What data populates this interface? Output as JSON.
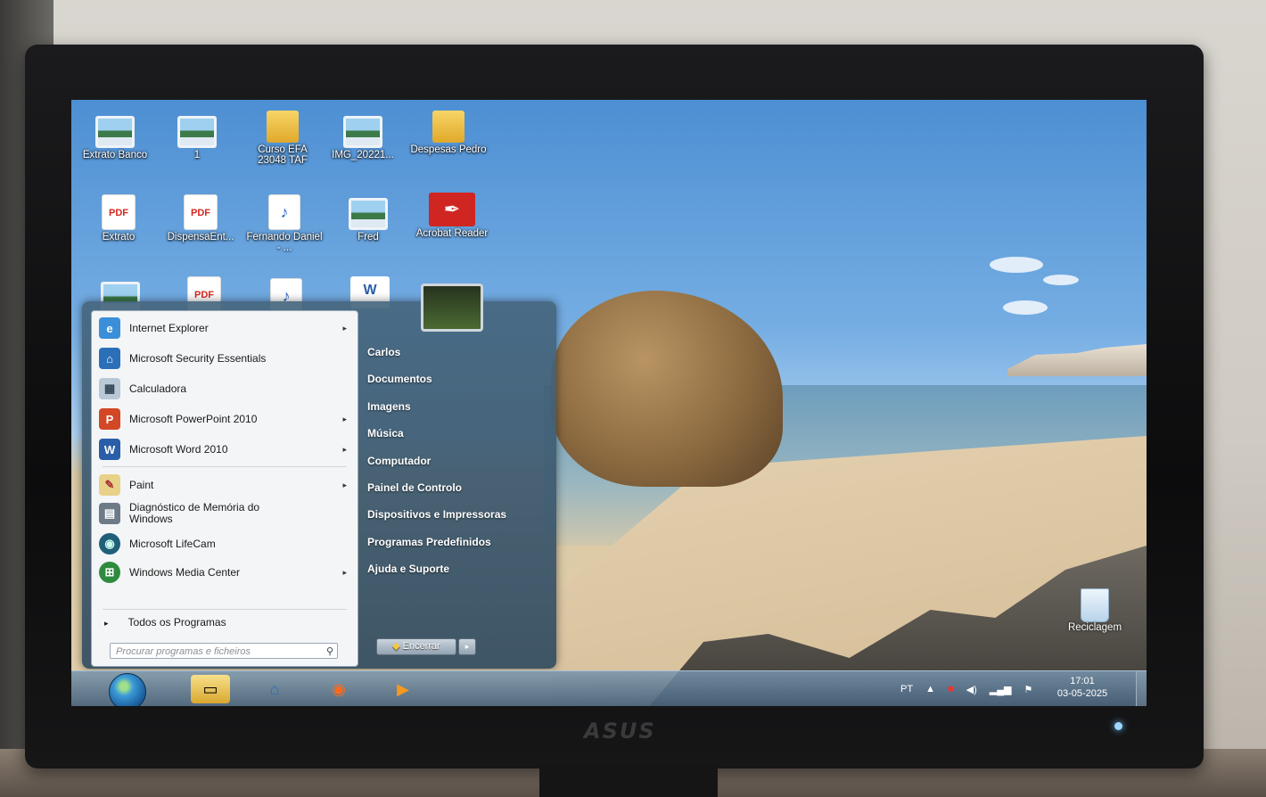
{
  "desktop": {
    "icons": [
      {
        "label": "Extrato Banco",
        "icon": "image-file-icon"
      },
      {
        "label": "1",
        "icon": "image-file-icon"
      },
      {
        "label": "Curso EFA 23048 TAF",
        "icon": "folder-shortcut-icon"
      },
      {
        "label": "IMG_20221...",
        "icon": "image-file-icon"
      },
      {
        "label": "Despesas Pedro",
        "icon": "folder-icon"
      },
      {
        "label": "Extrato",
        "icon": "pdf-icon"
      },
      {
        "label": "DispensaEnt...",
        "icon": "pdf-icon"
      },
      {
        "label": "Fernando Daniel - ...",
        "icon": "mp3-icon"
      },
      {
        "label": "Fred",
        "icon": "image-file-icon"
      },
      {
        "label": "Acrobat Reader",
        "icon": "acrobat-shortcut-icon"
      }
    ],
    "recycle_bin": {
      "label": "Reciclagem"
    }
  },
  "start_menu": {
    "programs": [
      {
        "label": "Internet Explorer",
        "has_submenu": true
      },
      {
        "label": "Microsoft Security Essentials",
        "has_submenu": false
      },
      {
        "label": "Calculadora",
        "has_submenu": false
      },
      {
        "label": "Microsoft PowerPoint 2010",
        "has_submenu": true
      },
      {
        "label": "Microsoft Word 2010",
        "has_submenu": true
      },
      {
        "label": "Paint",
        "has_submenu": true
      },
      {
        "label": "Diagnóstico de Memória do Windows",
        "has_submenu": false
      },
      {
        "label": "Microsoft LifeCam",
        "has_submenu": false
      },
      {
        "label": "Windows Media Center",
        "has_submenu": true
      }
    ],
    "all_programs": "Todos os Programas",
    "search_placeholder": "Procurar programas e ficheiros",
    "right_items": [
      "Carlos",
      "Documentos",
      "Imagens",
      "Música",
      "Computador",
      "Painel de Controlo",
      "Dispositivos e Impressoras",
      "Programas Predefinidos",
      "Ajuda e Suporte"
    ],
    "shutdown_label": "Encerrar"
  },
  "taskbar": {
    "language": "PT",
    "time": "17:01",
    "date": "03-05-2025",
    "pinned": [
      "windows-explorer-icon",
      "security-essentials-icon",
      "firefox-icon",
      "media-player-icon"
    ]
  },
  "monitor": {
    "brand": "ASUS"
  }
}
